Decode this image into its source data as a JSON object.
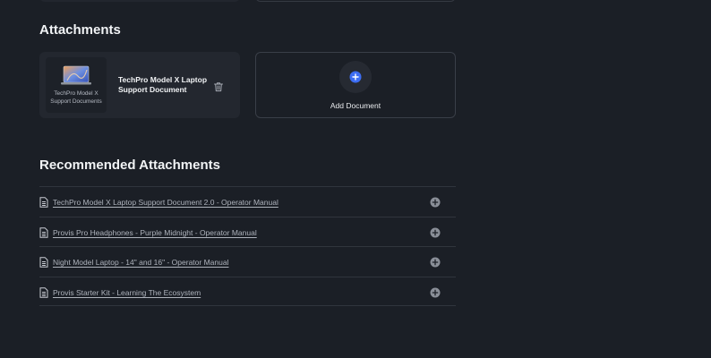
{
  "attachments": {
    "title": "Attachments",
    "items": [
      {
        "thumbnail_caption": "TechPro Model X\nSupport Documents",
        "title": "TechPro Model X Laptop Support Document"
      }
    ],
    "add_label": "Add Document"
  },
  "recommended": {
    "title": "Recommended Attachments",
    "items": [
      {
        "label": "TechPro Model X Laptop Support Document 2.0 - Operator Manual"
      },
      {
        "label": "Provis Pro Headphones - Purple Midnight - Operator Manual"
      },
      {
        "label": "Night Model Laptop - 14\" and 16\" - Operator Manual"
      },
      {
        "label": "Provis Starter Kit - Learning The Ecosystem"
      }
    ]
  },
  "colors": {
    "background": "#1b1f26",
    "card": "#23272f",
    "accent": "#3d6df2",
    "muted_icon": "#8a8f98"
  },
  "icons": {
    "trash": "trash-icon",
    "add": "plus-circle-icon",
    "document": "document-icon"
  }
}
